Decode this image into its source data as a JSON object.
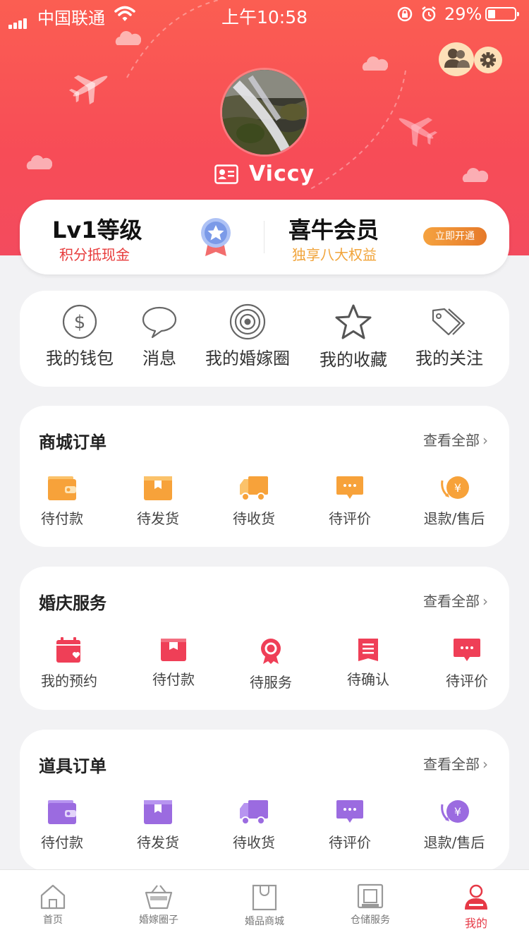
{
  "status_bar": {
    "carrier": "中国联通",
    "time": "上午10:58",
    "battery": "29%"
  },
  "profile": {
    "name": "Viccy"
  },
  "level_card": {
    "level_title": "Lv1等级",
    "level_sub": "积分抵现金",
    "vip_title": "喜牛会员",
    "vip_sub": "独享八大权益",
    "open_button": "立即开通"
  },
  "quick_actions": [
    {
      "label": "我的钱包",
      "icon": "dollar-circle-icon"
    },
    {
      "label": "消息",
      "icon": "chat-bubble-icon"
    },
    {
      "label": "我的婚嫁圈",
      "icon": "concentric-circles-icon"
    },
    {
      "label": "我的收藏",
      "icon": "star-icon"
    },
    {
      "label": "我的关注",
      "icon": "tags-icon"
    }
  ],
  "mall_orders": {
    "title": "商城订单",
    "more": "查看全部",
    "items": [
      {
        "label": "待付款",
        "icon": "wallet-icon"
      },
      {
        "label": "待发货",
        "icon": "box-icon"
      },
      {
        "label": "待收货",
        "icon": "truck-icon"
      },
      {
        "label": "待评价",
        "icon": "comment-icon"
      },
      {
        "label": "退款/售后",
        "icon": "refund-icon"
      }
    ],
    "color": "#f7a23a"
  },
  "wedding_services": {
    "title": "婚庆服务",
    "more": "查看全部",
    "items": [
      {
        "label": "我的预约",
        "icon": "calendar-heart-icon"
      },
      {
        "label": "待付款",
        "icon": "box-icon"
      },
      {
        "label": "待服务",
        "icon": "rosette-icon"
      },
      {
        "label": "待确认",
        "icon": "document-icon"
      },
      {
        "label": "待评价",
        "icon": "comment-icon"
      }
    ],
    "color": "#ef3f57"
  },
  "prop_orders": {
    "title": "道具订单",
    "more": "查看全部",
    "items": [
      {
        "label": "待付款",
        "icon": "wallet-icon"
      },
      {
        "label": "待发货",
        "icon": "box-icon"
      },
      {
        "label": "待收货",
        "icon": "truck-icon"
      },
      {
        "label": "待评价",
        "icon": "comment-icon"
      },
      {
        "label": "退款/售后",
        "icon": "refund-icon"
      }
    ],
    "color": "#9b6be0"
  },
  "tabbar": [
    {
      "label": "首页",
      "icon": "home-icon"
    },
    {
      "label": "婚嫁圈子",
      "icon": "basket-icon"
    },
    {
      "label": "婚品商城",
      "icon": "shopping-bag-icon"
    },
    {
      "label": "仓储服务",
      "icon": "storage-icon"
    },
    {
      "label": "我的",
      "icon": "user-icon",
      "active": true
    }
  ],
  "colors": {
    "hero": "#f74c57",
    "accent_red": "#e63946",
    "vip_gold": "#f1a43a"
  }
}
